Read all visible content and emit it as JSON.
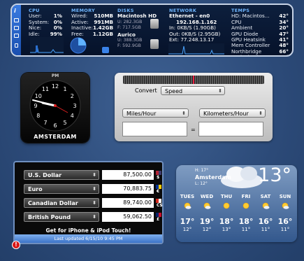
{
  "istat": {
    "cpu": {
      "header": "CPU",
      "rows": [
        [
          "User:",
          "1%"
        ],
        [
          "System:",
          "0%"
        ],
        [
          "Nice:",
          "0%"
        ],
        [
          "Idle:",
          "99%"
        ]
      ]
    },
    "memory": {
      "header": "MEMORY",
      "rows": [
        [
          "Wired:",
          "510MB"
        ],
        [
          "Active:",
          "991MB"
        ],
        [
          "Inactive:",
          "1.42GB"
        ],
        [
          "Free:",
          "1.12GB"
        ]
      ]
    },
    "disks": {
      "header": "DISKS",
      "items": [
        {
          "name": "Macintosh HD",
          "used": "U: 282.3GB",
          "free": "F: 717.5GB"
        },
        {
          "name": "Aurico",
          "used": "U: 388.3GB",
          "free": "F: 592.9GB"
        }
      ]
    },
    "network": {
      "header": "NETWORK",
      "iface": "Ethernet - en0",
      "ip": "192.168.1.162",
      "in": "In: 0KB/S (1.90GB)",
      "out": "Out: 0KB/S (2.95GB)",
      "ext": "Ext: 77.248.13.17"
    },
    "temps": {
      "header": "TEMPS",
      "rows": [
        [
          "HD: Macintos...",
          "42°"
        ],
        [
          "CPU",
          "34°"
        ],
        [
          "Ambient",
          "20°"
        ],
        [
          "GPU Diode",
          "47°"
        ],
        [
          "GPU Heatsink",
          "41°"
        ],
        [
          "Mem Controller",
          "48°"
        ],
        [
          "Northbridge",
          "66°"
        ],
        [
          "Optical Drive",
          "39°"
        ]
      ]
    }
  },
  "clock": {
    "ampm": "PM",
    "city": "AMSTERDAM",
    "numerals": [
      "12",
      "1",
      "2",
      "3",
      "4",
      "5",
      "6",
      "7",
      "8",
      "9",
      "10",
      "11"
    ]
  },
  "converter": {
    "label": "Convert",
    "category": "Speed",
    "from_unit": "Miles/Hour",
    "to_unit": "Kilometers/Hour",
    "from_value": "",
    "to_value": "",
    "equals": "="
  },
  "currency": {
    "rows": [
      {
        "name": "U.S. Dollar",
        "amount": "87,500.00",
        "symbol": "$"
      },
      {
        "name": "Euro",
        "amount": "70,883.75",
        "symbol": "€"
      },
      {
        "name": "Canadian Dollar",
        "amount": "89,740.00",
        "symbol": "C$"
      },
      {
        "name": "British Pound",
        "amount": "59,062.50",
        "symbol": "£"
      }
    ],
    "promo": "Get for iPhone & iPod Touch!",
    "updated": "Last updated 6/15/10 9:45 PM"
  },
  "weather": {
    "city": "Amsterdam",
    "high": "H: 17°",
    "low": "L: 12°",
    "current": "13°",
    "days": [
      {
        "name": "TUES",
        "high": "17°",
        "low": "12°",
        "icon": "sun-cloud-icon"
      },
      {
        "name": "WED",
        "high": "19°",
        "low": "12°",
        "icon": "sun-cloud-icon"
      },
      {
        "name": "THU",
        "high": "18°",
        "low": "13°",
        "icon": "sun-icon"
      },
      {
        "name": "FRI",
        "high": "18°",
        "low": "11°",
        "icon": "sun-icon"
      },
      {
        "name": "SAT",
        "high": "16°",
        "low": "11°",
        "icon": "sun-cloud-icon"
      },
      {
        "name": "SUN",
        "high": "16°",
        "low": "11°",
        "icon": "sun-cloud-icon"
      }
    ]
  },
  "colors": {
    "accent": "#3a7be0",
    "desktop": "#2f4f80",
    "alert": "#d81515"
  }
}
